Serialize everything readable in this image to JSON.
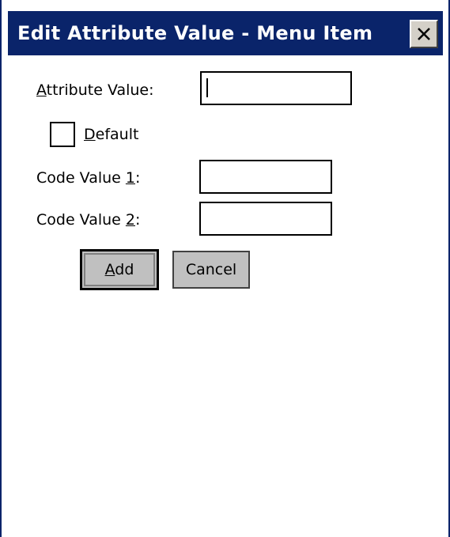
{
  "dialog": {
    "title": "Edit Attribute Value - Menu Item",
    "close_glyph": "✕"
  },
  "form": {
    "attribute_value": {
      "label_prefix": "",
      "label_mnemonic": "A",
      "label_suffix": "ttribute Value:",
      "value": ""
    },
    "default_checkbox": {
      "label_mnemonic": "D",
      "label_suffix": "efault",
      "checked": false
    },
    "code_value_1": {
      "label_prefix": "Code Value ",
      "label_mnemonic": "1",
      "label_suffix": ":",
      "value": ""
    },
    "code_value_2": {
      "label_prefix": "Code Value ",
      "label_mnemonic": "2",
      "label_suffix": ":",
      "value": ""
    }
  },
  "buttons": {
    "add": {
      "mnemonic": "A",
      "suffix": "dd"
    },
    "cancel": {
      "label": "Cancel"
    }
  },
  "colors": {
    "titlebar": "#0a246a",
    "button_face": "#c0c0c0"
  },
  "icons": {
    "close": "close-icon"
  }
}
